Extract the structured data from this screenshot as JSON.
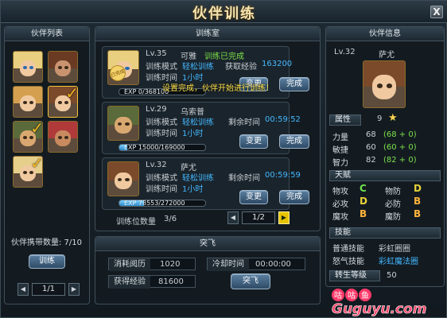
{
  "window": {
    "title": "伙伴训练",
    "close_label": "X"
  },
  "list_panel": {
    "title": "伙伴列表",
    "carry_label": "伙伴携带数量: 7/10",
    "train_button": "训练",
    "pager": {
      "prev": "◀",
      "page": "1/1",
      "next": "▶"
    },
    "portraits": [
      {
        "name": "portrait-1",
        "checked": false
      },
      {
        "name": "portrait-2",
        "checked": false
      },
      {
        "name": "portrait-3",
        "checked": false
      },
      {
        "name": "portrait-4",
        "checked": true
      },
      {
        "name": "portrait-5",
        "checked": true
      },
      {
        "name": "portrait-6",
        "checked": false
      },
      {
        "name": "portrait-7",
        "checked": true
      }
    ]
  },
  "training_room": {
    "title": "训练室",
    "slots_label": "训练位数量",
    "slots_value": "3/6",
    "pager": {
      "prev": "◀",
      "page": "1/2",
      "next": "▶"
    },
    "notice": "设置完成，伙伴开始进行训练！",
    "cards": [
      {
        "level": "Lv.35",
        "name": "可雅",
        "status": "训练已完成",
        "mode_label": "训练模式",
        "mode_value": "轻松训练",
        "reward_label": "获取经验",
        "reward_value": "163200",
        "time_label": "训练时间",
        "time_value": "1小时",
        "exp_text": "EXP 0/368100",
        "exp_fraction": 0.0,
        "badge": "已完成",
        "buttons": [
          "变更",
          "完成"
        ]
      },
      {
        "level": "Lv.29",
        "name": "乌索普",
        "mode_label": "训练模式",
        "mode_value": "轻松训练",
        "remain_label": "剩余时间",
        "remain_value": "00:59:52",
        "time_label": "训练时间",
        "time_value": "1小时",
        "exp_text": "EXP 15000/169000",
        "exp_fraction": 0.09,
        "buttons": [
          "变更",
          "完成"
        ]
      },
      {
        "level": "Lv.32",
        "name": "萨尤",
        "mode_label": "训练模式",
        "mode_value": "轻松训练",
        "remain_label": "剩余时间",
        "remain_value": "00:59:59",
        "time_label": "训练时间",
        "time_value": "1小时",
        "exp_text": "EXP 78553/272000",
        "exp_fraction": 0.29,
        "buttons": [
          "变更",
          "完成"
        ]
      }
    ]
  },
  "breakout": {
    "title": "突飞",
    "cost_label": "消耗阅历",
    "cost_value": "1020",
    "cooldown_label": "冷却时间",
    "cooldown_value": "00:00:00",
    "gain_label": "获得经验",
    "gain_value": "81600",
    "button": "突飞"
  },
  "info_panel": {
    "title": "伙伴信息",
    "level": "Lv.32",
    "name": "萨尤",
    "attr_label": "属性",
    "attr_value": "9",
    "stats": [
      {
        "label": "力量",
        "value": "68",
        "detail": "(68 + 0)"
      },
      {
        "label": "敏捷",
        "value": "60",
        "detail": "(60 + 0)"
      },
      {
        "label": "智力",
        "value": "82",
        "detail": "(82 + 0)"
      }
    ],
    "talent_label": "天赋",
    "talents": [
      {
        "label": "物攻",
        "grade": "C"
      },
      {
        "label": "物防",
        "grade": "D"
      },
      {
        "label": "必攻",
        "grade": "D"
      },
      {
        "label": "必防",
        "grade": "B"
      },
      {
        "label": "魔攻",
        "grade": "B"
      },
      {
        "label": "魔防",
        "grade": "B"
      }
    ],
    "skill_label": "技能",
    "skills": [
      {
        "label": "普通技能",
        "value": "彩虹圈圈"
      },
      {
        "label": "怒气技能",
        "value": "彩虹魔法圈"
      }
    ],
    "rebirth_label": "转生等级",
    "rebirth_value": "50"
  },
  "watermark": {
    "text": "Guguyu.com",
    "chars": [
      "咕",
      "咕",
      "鱼"
    ]
  }
}
